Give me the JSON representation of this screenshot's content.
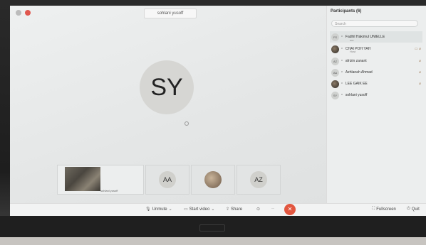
{
  "window": {
    "title_tag": "sohlani yusoff"
  },
  "main_video": {
    "initials": "SY"
  },
  "thumbnails": [
    {
      "kind": "camera",
      "label": "sohlani yusoff"
    },
    {
      "kind": "initials",
      "label": "AA"
    },
    {
      "kind": "photo",
      "label": ""
    },
    {
      "kind": "initials",
      "label": "AZ"
    }
  ],
  "toolbar": {
    "unmute": "Unmute",
    "start_video": "Start video",
    "share": "Share",
    "fullscreen": "Fullscreen",
    "quit": "Quit",
    "end_icon": "close-icon"
  },
  "participants": {
    "title": "Participants (6)",
    "search_placeholder": "Search",
    "items": [
      {
        "initials": "FS",
        "name": "Fadhil Hakimul UNIELLE",
        "sub": "me"
      },
      {
        "initials": "",
        "name": "CHAI POH YAH",
        "sub": "Host"
      },
      {
        "initials": "AZ",
        "name": "afrizin zanant",
        "sub": ""
      },
      {
        "initials": "AA",
        "name": "Azhlanah Ahmad",
        "sub": ""
      },
      {
        "initials": "",
        "name": "LEE GAIK EE",
        "sub": ""
      },
      {
        "initials": "SY",
        "name": "sohlani yusoff",
        "sub": ""
      }
    ]
  },
  "colors": {
    "end_button": "#e2563f",
    "accent": "#e0574e"
  }
}
